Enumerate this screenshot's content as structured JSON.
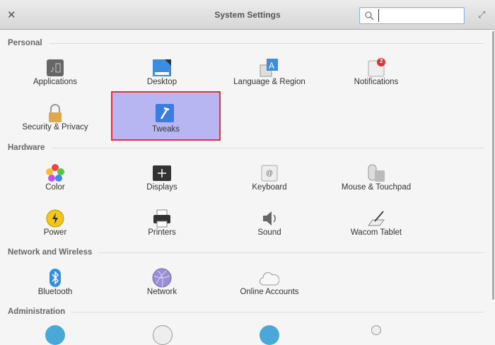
{
  "window": {
    "title": "System Settings",
    "search_value": "",
    "search_placeholder": ""
  },
  "sections": [
    {
      "title": "Personal",
      "items": [
        "Applications",
        "Desktop",
        "Language & Region",
        "Notifications",
        "Security & Privacy",
        "Tweaks"
      ]
    },
    {
      "title": "Hardware",
      "items": [
        "Color",
        "Displays",
        "Keyboard",
        "Mouse & Touchpad",
        "Power",
        "Printers",
        "Sound",
        "Wacom Tablet"
      ]
    },
    {
      "title": "Network and Wireless",
      "items": [
        "Bluetooth",
        "Network",
        "Online Accounts"
      ]
    },
    {
      "title": "Administration",
      "items": []
    }
  ],
  "notifications_badge": "2",
  "selected_item": "Tweaks",
  "colors": {
    "selection": "#b7b6f3",
    "selection_border": "#d9343f"
  }
}
